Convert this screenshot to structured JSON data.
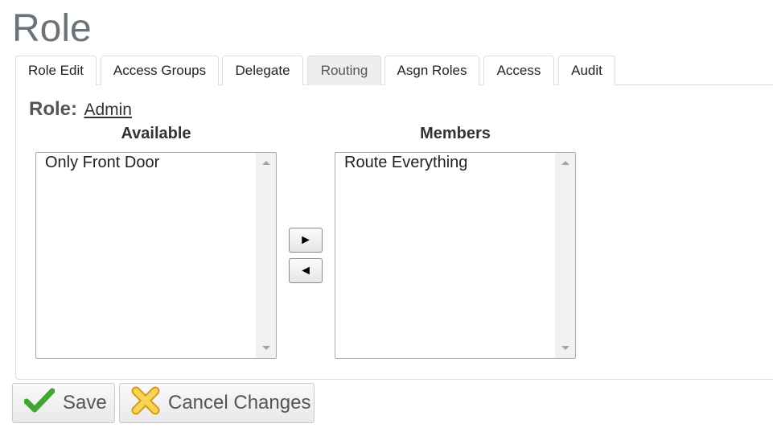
{
  "page": {
    "title": "Role"
  },
  "tabs": [
    {
      "label": "Role Edit",
      "active": false
    },
    {
      "label": "Access Groups",
      "active": false
    },
    {
      "label": "Delegate",
      "active": false
    },
    {
      "label": "Routing",
      "active": true
    },
    {
      "label": "Asgn Roles",
      "active": false
    },
    {
      "label": "Access",
      "active": false
    },
    {
      "label": "Audit",
      "active": false
    }
  ],
  "role": {
    "label": "Role:",
    "value": "Admin"
  },
  "available": {
    "heading": "Available",
    "items": [
      "Only Front Door"
    ]
  },
  "members": {
    "heading": "Members",
    "items": [
      "Route Everything"
    ]
  },
  "transfer": {
    "add_label": "►",
    "remove_label": "◄"
  },
  "actions": {
    "save_label": "Save",
    "cancel_label": "Cancel Changes"
  },
  "colors": {
    "title": "#6b7378",
    "active_tab": "#eeeeee",
    "save_icon": "#3fa62f",
    "cancel_icon": "#f2c53d"
  },
  "icons": {
    "save": "check-icon",
    "cancel": "x-icon"
  }
}
